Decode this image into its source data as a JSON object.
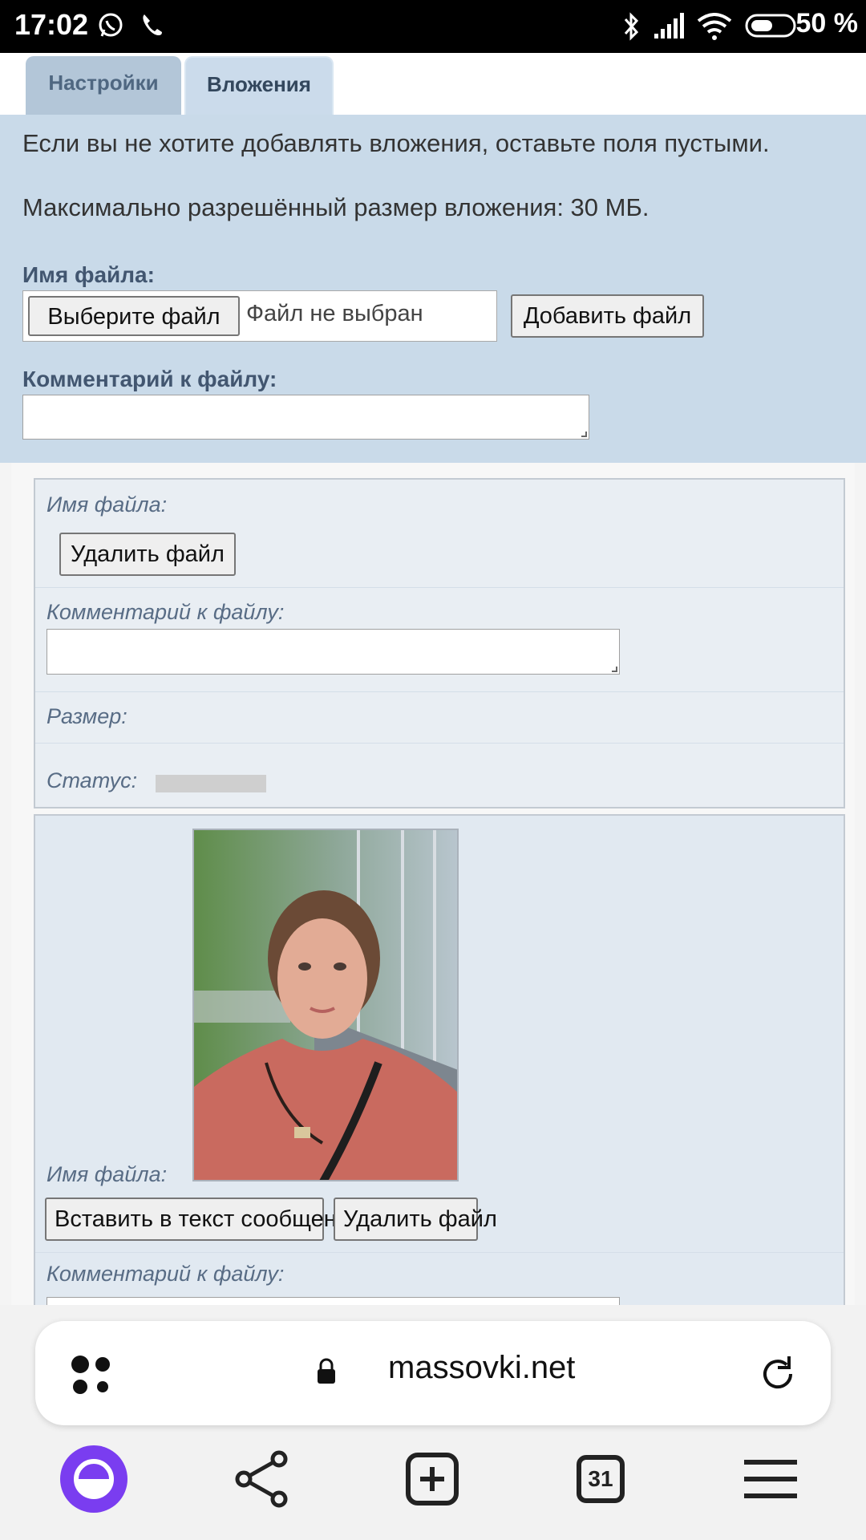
{
  "status_bar": {
    "time": "17:02",
    "battery": "50 %",
    "icons": [
      "whatsapp-icon",
      "phone-icon",
      "bluetooth-icon",
      "signal-icon",
      "wifi-icon",
      "battery-icon"
    ]
  },
  "tabs": [
    {
      "label": "Настройки",
      "active": false
    },
    {
      "label": "Вложения",
      "active": true
    }
  ],
  "upload": {
    "note1": "Если вы не хотите добавлять вложения, оставьте поля пустыми.",
    "note2": "Максимально разрешённый размер вложения: 30 МБ.",
    "filename_label": "Имя файла:",
    "choose_file": "Выберите файл",
    "no_file": "Файл не выбран",
    "add_file": "Добавить файл",
    "comment_label": "Комментарий к файлу:",
    "comment_value": ""
  },
  "attachments": [
    {
      "filename_label": "Имя файла:",
      "delete_label": "Удалить файл",
      "comment_label": "Комментарий к файлу:",
      "comment_value": "",
      "size_label": "Размер:",
      "status_label": "Статус:"
    },
    {
      "filename_label": "Имя файла:",
      "insert_label": "Вставить в текст сообщения",
      "delete_label": "Удалить файл",
      "comment_label": "Комментарий к файлу:"
    }
  ],
  "browser": {
    "url": "massovki.net",
    "tabs_count": "31",
    "colors": {
      "alice": "#7a3df0",
      "panel": "#c9dae9"
    }
  }
}
